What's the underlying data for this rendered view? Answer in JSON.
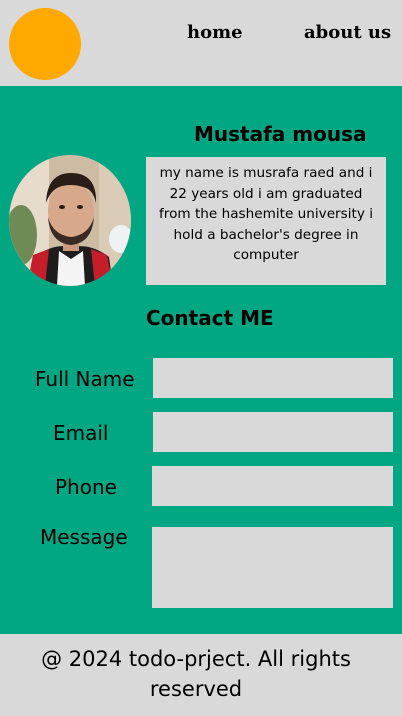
{
  "header": {
    "nav": {
      "home": "home",
      "about": "about us"
    },
    "logo_color": "#ffa800"
  },
  "profile": {
    "name": "Mustafa mousa",
    "bio": "my name is musrafa raed and i 22 years old i am graduated from the hashemite university i hold a bachelor's degree in computer"
  },
  "contact": {
    "title": "Contact ME",
    "fields": {
      "full_name": {
        "label": "Full Name",
        "value": ""
      },
      "email": {
        "label": "Email",
        "value": ""
      },
      "phone": {
        "label": "Phone",
        "value": ""
      },
      "message": {
        "label": "Message",
        "value": ""
      }
    }
  },
  "footer": {
    "text": "@  2024 todo-prject. All rights reserved"
  },
  "colors": {
    "main_background": "#01a783",
    "header_footer_background": "#d9d9d9",
    "logo": "#ffa800"
  }
}
